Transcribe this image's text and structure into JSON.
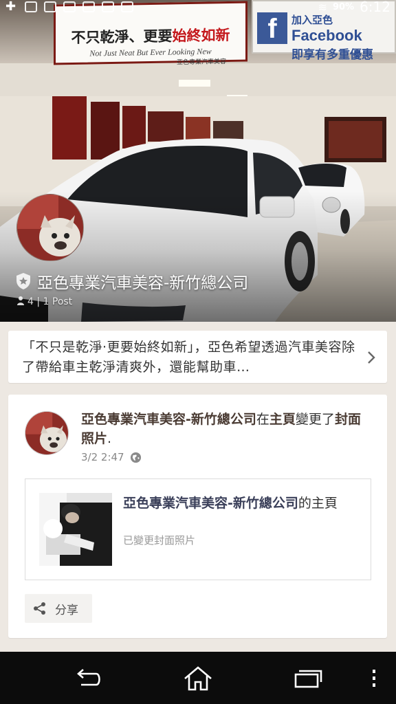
{
  "status_bar": {
    "battery": "90%",
    "time": "6:12"
  },
  "cover": {
    "sign_left_zh_1": "不只乾淨、更要",
    "sign_left_zh_2": "始終如新",
    "sign_left_en": "Not Just Neat But Ever Looking New",
    "sign_left_shop": "亞色專業汽車美容",
    "sign_right_top": "加入亞色",
    "sign_right_brand": "Facebook",
    "sign_right_sub": "即享有多重優惠"
  },
  "page": {
    "name": "亞色專業汽車美容-新竹總公司",
    "stats": "4 | 1 Post"
  },
  "about": {
    "text": "「不只是乾淨·更要始終如新」，亞色希望透過汽車美容除了帶給車主乾淨清爽外，還能幫助車…"
  },
  "post": {
    "author": "亞色專業汽車美容-新竹總公司",
    "action_before": "在",
    "action_bold": "主頁",
    "action_after": "變更了",
    "action_bold2": "封面照片",
    "action_end": ".",
    "time": "3/2 2:47",
    "link_title_bold": "亞色專業汽車美容-新竹總公司",
    "link_title_rest": "的主頁",
    "link_subtitle": "已變更封面照片",
    "share_label": "分享"
  },
  "colors": {
    "background": "#ede8e2",
    "card": "#ffffff",
    "nav_bar": "#0c0c0c",
    "sign_border": "#7b1a14",
    "facebook_blue": "#3b5998"
  }
}
